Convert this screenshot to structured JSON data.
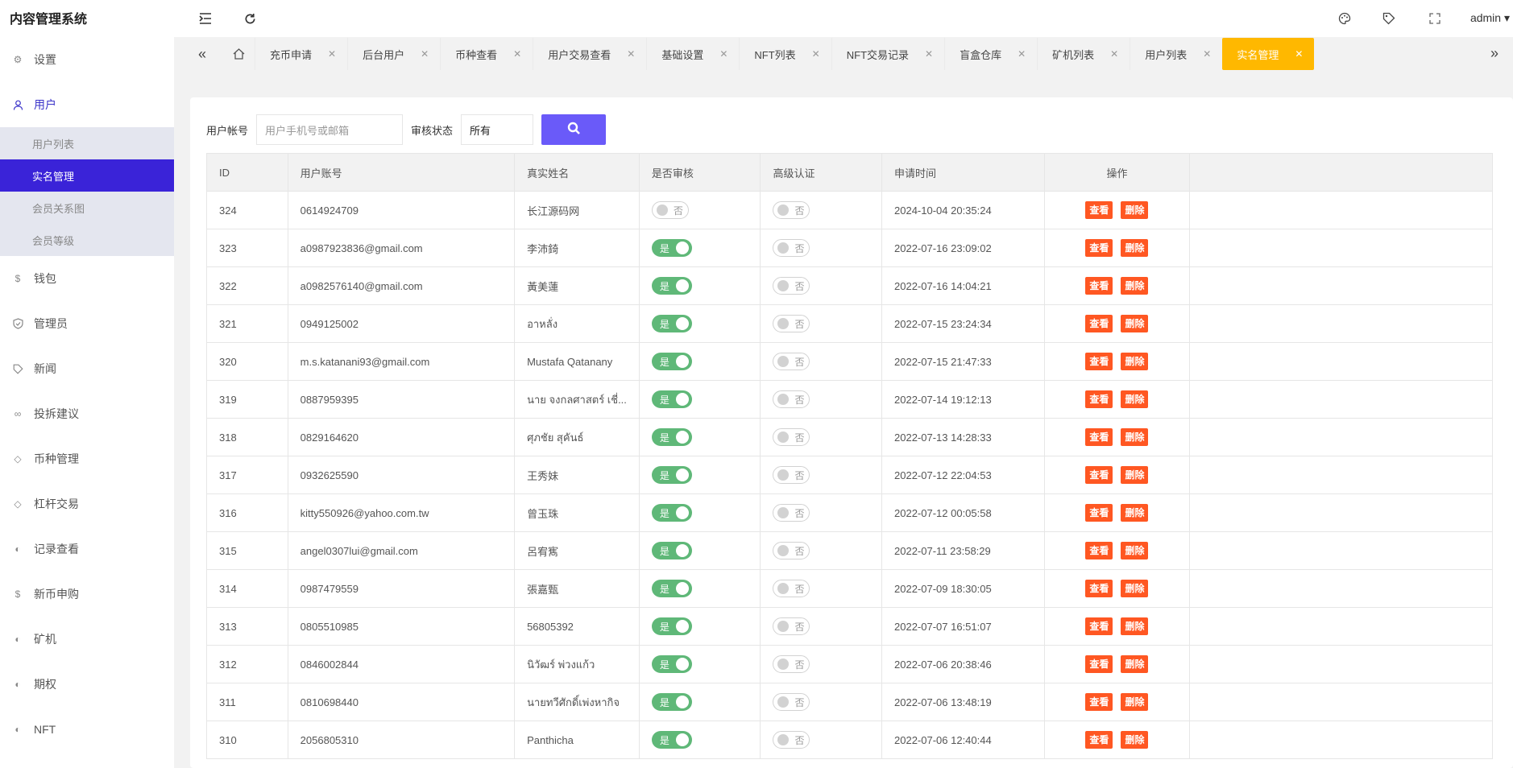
{
  "app_title": "内容管理系统",
  "header": {
    "user": "admin ▾"
  },
  "sidebar": {
    "items": [
      {
        "label": "设置"
      },
      {
        "label": "用户"
      },
      {
        "label": "钱包"
      },
      {
        "label": "管理员"
      },
      {
        "label": "新闻"
      },
      {
        "label": "投拆建议"
      },
      {
        "label": "币种管理"
      },
      {
        "label": "杠杆交易"
      },
      {
        "label": "记录查看"
      },
      {
        "label": "新币申购"
      },
      {
        "label": "矿机"
      },
      {
        "label": "期权"
      },
      {
        "label": "NFT"
      }
    ],
    "sub_items": [
      {
        "label": "用户列表"
      },
      {
        "label": "实名管理"
      },
      {
        "label": "会员关系图"
      },
      {
        "label": "会员等级"
      }
    ]
  },
  "tabs": [
    {
      "label": "充币申请"
    },
    {
      "label": "后台用户"
    },
    {
      "label": "币种查看"
    },
    {
      "label": "用户交易查看"
    },
    {
      "label": "基础设置"
    },
    {
      "label": "NFT列表"
    },
    {
      "label": "NFT交易记录"
    },
    {
      "label": "盲盒仓库"
    },
    {
      "label": "矿机列表"
    },
    {
      "label": "用户列表"
    },
    {
      "label": "实名管理"
    }
  ],
  "search": {
    "account_label": "用户帐号",
    "account_placeholder": "用户手机号或邮箱",
    "status_label": "审核状态",
    "status_value": "所有"
  },
  "table": {
    "headers": [
      "ID",
      "用户账号",
      "真实姓名",
      "是否审核",
      "高级认证",
      "申请时间",
      "操作"
    ],
    "yes": "是",
    "no": "否",
    "view_label": "查看",
    "delete_label": "删除",
    "rows": [
      {
        "id": "324",
        "account": "0614924709",
        "name": "长江源码网",
        "audited": false,
        "advanced": false,
        "time": "2024-10-04 20:35:24"
      },
      {
        "id": "323",
        "account": "a0987923836@gmail.com",
        "name": "李沛錡",
        "audited": true,
        "advanced": false,
        "time": "2022-07-16 23:09:02"
      },
      {
        "id": "322",
        "account": "a0982576140@gmail.com",
        "name": "黃美蓮",
        "audited": true,
        "advanced": false,
        "time": "2022-07-16 14:04:21"
      },
      {
        "id": "321",
        "account": "0949125002",
        "name": "อาหลั่ง",
        "audited": true,
        "advanced": false,
        "time": "2022-07-15 23:24:34"
      },
      {
        "id": "320",
        "account": "m.s.katanani93@gmail.com",
        "name": "Mustafa Qatanany",
        "audited": true,
        "advanced": false,
        "time": "2022-07-15 21:47:33"
      },
      {
        "id": "319",
        "account": "0887959395",
        "name": "นาย จงกลศาสตร์ เชี่...",
        "audited": true,
        "advanced": false,
        "time": "2022-07-14 19:12:13"
      },
      {
        "id": "318",
        "account": "0829164620",
        "name": "ศุภชัย สุคันธ์",
        "audited": true,
        "advanced": false,
        "time": "2022-07-13 14:28:33"
      },
      {
        "id": "317",
        "account": "0932625590",
        "name": "王秀妹",
        "audited": true,
        "advanced": false,
        "time": "2022-07-12 22:04:53"
      },
      {
        "id": "316",
        "account": "kitty550926@yahoo.com.tw",
        "name": "曾玉珠",
        "audited": true,
        "advanced": false,
        "time": "2022-07-12 00:05:58"
      },
      {
        "id": "315",
        "account": "angel0307lui@gmail.com",
        "name": "呂宥寯",
        "audited": true,
        "advanced": false,
        "time": "2022-07-11 23:58:29"
      },
      {
        "id": "314",
        "account": "0987479559",
        "name": "張嘉甄",
        "audited": true,
        "advanced": false,
        "time": "2022-07-09 18:30:05"
      },
      {
        "id": "313",
        "account": "0805510985",
        "name": "56805392",
        "audited": true,
        "advanced": false,
        "time": "2022-07-07 16:51:07"
      },
      {
        "id": "312",
        "account": "0846002844",
        "name": "นิวัฒร์ พ่วงแก้ว",
        "audited": true,
        "advanced": false,
        "time": "2022-07-06 20:38:46"
      },
      {
        "id": "311",
        "account": "0810698440",
        "name": "นายทวีศักดิ์เพ่งหากิจ",
        "audited": true,
        "advanced": false,
        "time": "2022-07-06 13:48:19"
      },
      {
        "id": "310",
        "account": "2056805310",
        "name": "Panthicha",
        "audited": true,
        "advanced": false,
        "time": "2022-07-06 12:40:44"
      }
    ]
  },
  "colors": {
    "accent": "#3a23d8",
    "active_tab": "#ffb800",
    "search_button": "#6a5af9",
    "switch_on": "#5fb878",
    "danger": "#ff5722"
  }
}
